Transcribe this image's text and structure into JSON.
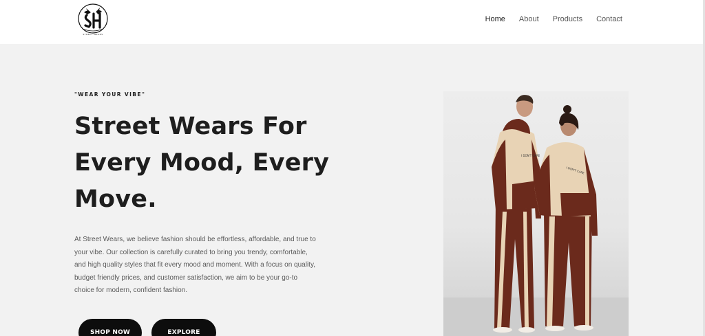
{
  "brand": {
    "logo_text": "STREET WEARS"
  },
  "nav": {
    "items": [
      {
        "label": "Home",
        "active": true
      },
      {
        "label": "About",
        "active": false
      },
      {
        "label": "Products",
        "active": false
      },
      {
        "label": "Contact",
        "active": false
      }
    ]
  },
  "hero": {
    "tagline": "\"WEAR YOUR VIBE\"",
    "headline": "Street Wears For Every Mood, Every Move.",
    "description": "At Street Wears, we believe fashion should be effortless, affordable, and true to your vibe. Our collection is carefully curated to bring you trendy, comfortable, and high quality styles that fit every mood and moment. With a focus on quality, budget friendly prices, and customer satisfaction, we aim to be your go-to choice for modern, confident fashion.",
    "buttons": {
      "shop_now": "SHOP NOW",
      "explore": "EXPLORE"
    },
    "photo_print": "I DON'T CARE"
  },
  "colors": {
    "background": "#f2f2f2",
    "header": "#ffffff",
    "button": "#0d0d0d",
    "hoodie_cream": "#e8d3b5",
    "hoodie_brown": "#6b2a1c"
  }
}
